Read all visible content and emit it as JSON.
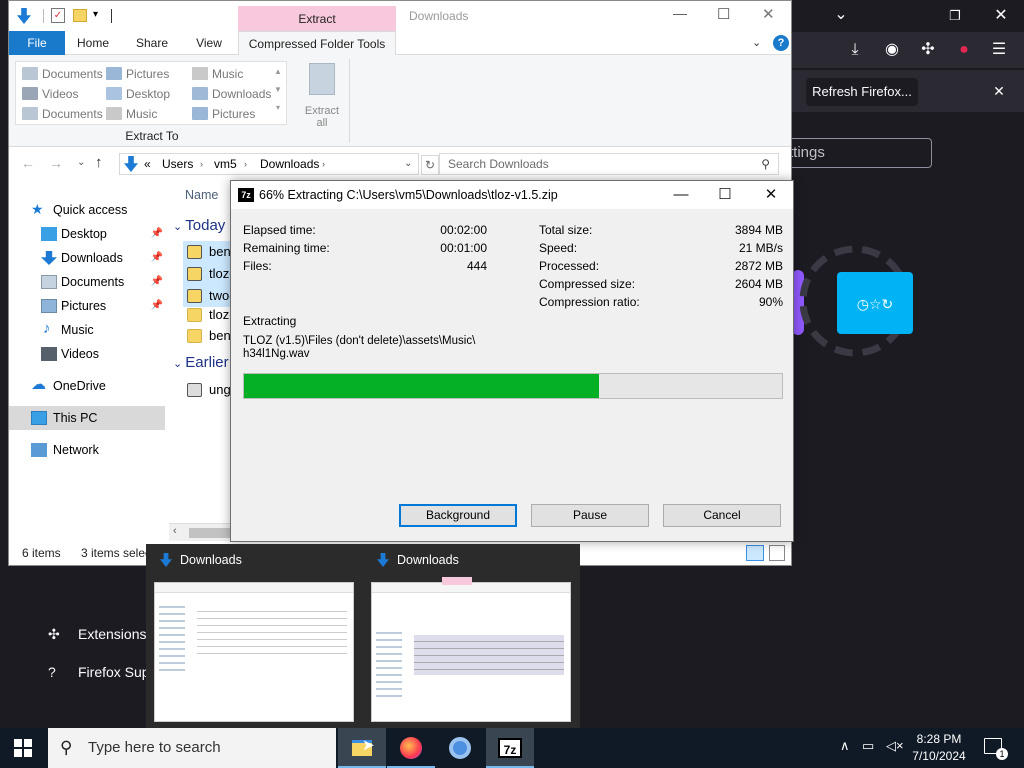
{
  "firefox": {
    "refresh_label": "Refresh Firefox...",
    "settings_text": "ttings",
    "sidebar_extensions": "Extensions",
    "sidebar_support": "Firefox Sup"
  },
  "explorer": {
    "title": "Downloads",
    "context_tab": "Extract",
    "tabs": [
      "File",
      "Home",
      "Share",
      "View",
      "Compressed Folder Tools"
    ],
    "ribbon_locations": [
      [
        "Documents",
        "Pictures",
        "Music"
      ],
      [
        "Videos",
        "Desktop",
        "Downloads"
      ],
      [
        "Documents",
        "Music",
        "Pictures"
      ]
    ],
    "extract_all": "Extract\nall",
    "extract_to": "Extract To",
    "breadcrumb": [
      "Users",
      "vm5",
      "Downloads"
    ],
    "breadcrumb_lead": "«",
    "search_placeholder": "Search Downloads",
    "column_name": "Name",
    "nav": {
      "quick_access": "Quick access",
      "desktop": "Desktop",
      "downloads": "Downloads",
      "documents": "Documents",
      "pictures": "Pictures",
      "music": "Music",
      "videos": "Videos",
      "onedrive": "OneDrive",
      "this_pc": "This PC",
      "network": "Network"
    },
    "groups": {
      "today": "Today",
      "earlier": "Earlier"
    },
    "files": [
      "ben.",
      "tloz-",
      "two-",
      "tloz-",
      "ben.",
      "ungo"
    ],
    "status_items": "6 items",
    "status_selected": "3 items selec"
  },
  "dialog": {
    "title": "66% Extracting C:\\Users\\vm5\\Downloads\\tloz-v1.5.zip",
    "icon": "7z",
    "elapsed_label": "Elapsed time:",
    "elapsed_value": "00:02:00",
    "remaining_label": "Remaining time:",
    "remaining_value": "00:01:00",
    "files_label": "Files:",
    "files_value": "444",
    "total_label": "Total size:",
    "total_value": "3894 MB",
    "speed_label": "Speed:",
    "speed_value": "21 MB/s",
    "processed_label": "Processed:",
    "processed_value": "2872 MB",
    "compressed_label": "Compressed size:",
    "compressed_value": "2604 MB",
    "ratio_label": "Compression ratio:",
    "ratio_value": "90%",
    "extracting_label": "Extracting",
    "current_path_line1": "TLOZ (v1.5)\\Files (don't delete)\\assets\\Music\\",
    "current_path_line2": "h34l1Ng.wav",
    "progress": 0.66,
    "progress_color": "#06b025",
    "background_btn": "Background",
    "pause_btn": "Pause",
    "cancel_btn": "Cancel"
  },
  "thumbnails": [
    {
      "title": "Downloads"
    },
    {
      "title": "Downloads"
    }
  ],
  "taskbar": {
    "search_placeholder": "Type here to search",
    "time": "8:28 PM",
    "date": "7/10/2024",
    "notif_count": "1"
  }
}
